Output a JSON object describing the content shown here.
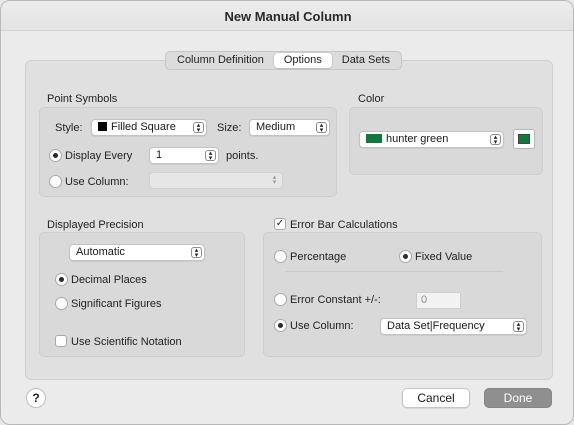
{
  "window": {
    "title": "New Manual Column"
  },
  "tabs": [
    {
      "label": "Column Definition",
      "active": false
    },
    {
      "label": "Options",
      "active": true
    },
    {
      "label": "Data Sets",
      "active": false
    }
  ],
  "point_symbols": {
    "heading": "Point Symbols",
    "style_label": "Style:",
    "style_value": "Filled Square",
    "size_label": "Size:",
    "size_value": "Medium",
    "display_every_label": "Display Every",
    "display_every_value": "1",
    "points_label": "points.",
    "use_column_label": "Use Column:",
    "use_column_value": ""
  },
  "color": {
    "heading": "Color",
    "value": "hunter green",
    "swatch": "#0f7a3c"
  },
  "displayed_precision": {
    "heading": "Displayed Precision",
    "mode_value": "Automatic",
    "decimal_places_label": "Decimal Places",
    "significant_figures_label": "Significant Figures",
    "scientific_label": "Use Scientific Notation"
  },
  "error_bars": {
    "heading": "Error Bar Calculations",
    "percentage_label": "Percentage",
    "fixed_value_label": "Fixed Value",
    "error_constant_label": "Error Constant +/-:",
    "error_constant_value": "0",
    "use_column_label": "Use Column:",
    "use_column_value": "Data Set|Frequency"
  },
  "footer": {
    "help_label": "?",
    "cancel_label": "Cancel",
    "done_label": "Done"
  }
}
